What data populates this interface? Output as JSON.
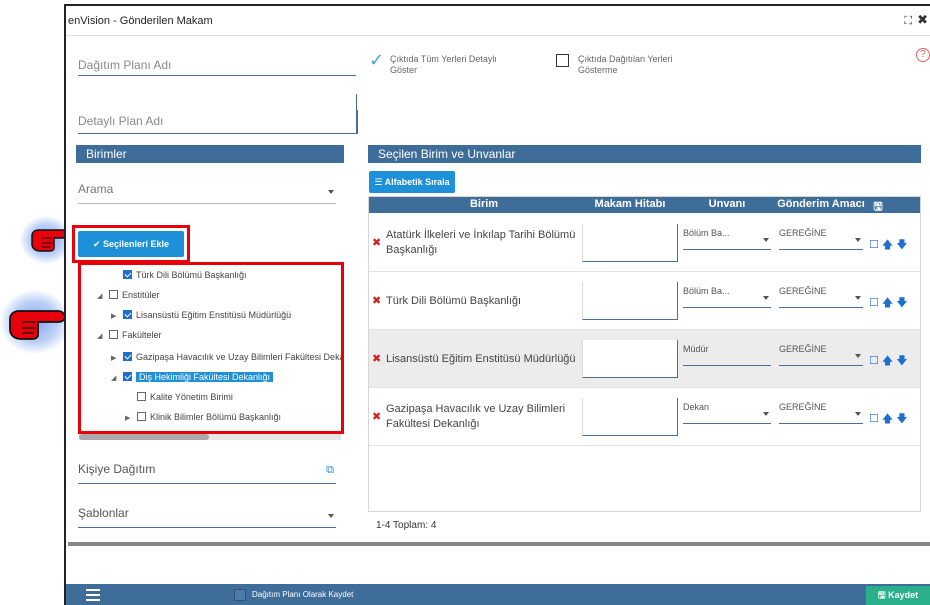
{
  "window": {
    "title": "enVision - Gönderilen Makam",
    "ctrl_restore": "⛶",
    "ctrl_close": "✖"
  },
  "form": {
    "plan_name_placeholder": "Dağıtım Planı Adı",
    "detail_plan_placeholder": "Detaylı Plan Adı",
    "opt_show_all_detailed": "Çıktıda Tüm Yerleri Detaylı Göster",
    "opt_hide_distributed": "Çıktıda Dağıtılan Yerleri Gösterme",
    "help": "?"
  },
  "left": {
    "header": "Birimler",
    "search_placeholder": "Arama",
    "add_selected_button": "Seçilenleri Ekle",
    "tree": [
      {
        "label": "Türk Dili Bölümü Başkanlığı",
        "checked": true
      },
      {
        "label": "Enstitüler",
        "checked": false
      },
      {
        "label": "Lisansüstü Eğitim Enstitüsü Müdürlüğü",
        "checked": true
      },
      {
        "label": "Fakülteler",
        "checked": false
      },
      {
        "label": "Gazipaşa Havacılık ve Uzay Bilimleri Fakültesi Dekanlığı",
        "checked": true
      },
      {
        "label": "Diş Hekimliği Fakültesi Dekanlığı",
        "checked": true
      },
      {
        "label": "Kalite Yönetim Birimi",
        "checked": false
      },
      {
        "label": "Klinik Bilimler Bölümü Başkanlığı",
        "checked": false
      }
    ],
    "kisiye_label": "Kişiye Dağıtım",
    "sablon_label": "Şablonlar"
  },
  "right": {
    "header": "Seçilen Birim ve Unvanlar",
    "sort_button": "Alfabetik Sırala",
    "columns": [
      "Birim",
      "Makam Hitabı",
      "Unvanı",
      "Gönderim Amacı"
    ],
    "rows": [
      {
        "birim": "Atatürk İlkeleri ve İnkılap Tarihi Bölümü Başkanlığı",
        "unvan": "Bölüm Ba...",
        "amac": "GEREĞİNE"
      },
      {
        "birim": "Türk Dili Bölümü Başkanlığı",
        "unvan": "Bölüm Ba...",
        "amac": "GEREĞİNE"
      },
      {
        "birim": "Lisansüstü Eğitim Enstitüsü Müdürlüğü",
        "unvan": "Müdür",
        "amac": "GEREĞİNE"
      },
      {
        "birim": "Gazipaşa Havacılık ve Uzay Bilimleri Fakültesi Dekanlığı",
        "unvan": "Dekan",
        "amac": "GEREĞİNE"
      }
    ],
    "total": "1-4 Toplam: 4"
  },
  "footer": {
    "save_as_plan": "Dağıtım Planı Olarak Kaydet",
    "save_button": "Kaydet"
  },
  "colors": {
    "primary": "#1e90d8",
    "header_bar": "#3e6d99",
    "highlight_red": "#e8000b",
    "save_green": "#29b08a"
  }
}
